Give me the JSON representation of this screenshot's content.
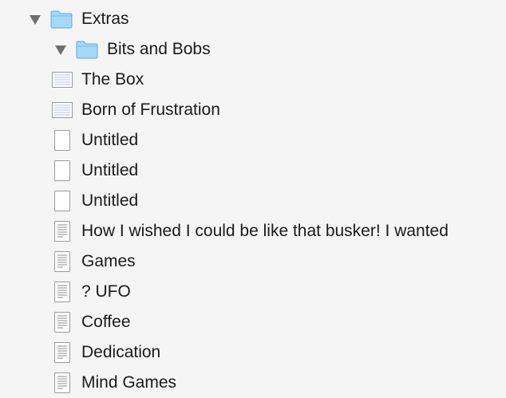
{
  "binder": {
    "rows": [
      {
        "label": "Extras",
        "icon": "folder-icon",
        "depth": 0,
        "expanded": true
      },
      {
        "label": "Bits and Bobs",
        "icon": "folder-icon",
        "depth": 1,
        "expanded": true
      },
      {
        "label": "The Box",
        "icon": "lined-document-icon",
        "depth": 0
      },
      {
        "label": "Born of Frustration",
        "icon": "lined-document-icon",
        "depth": 0
      },
      {
        "label": "Untitled",
        "icon": "blank-document-icon",
        "depth": 0
      },
      {
        "label": "Untitled",
        "icon": "blank-document-icon",
        "depth": 0
      },
      {
        "label": "Untitled",
        "icon": "blank-document-icon",
        "depth": 0
      },
      {
        "label": "How I wished I could be like that busker! I wanted",
        "icon": "text-document-icon",
        "depth": 0
      },
      {
        "label": "Games",
        "icon": "text-document-icon",
        "depth": 0
      },
      {
        "label": "? UFO",
        "icon": "text-document-icon",
        "depth": 0
      },
      {
        "label": "Coffee",
        "icon": "text-document-icon",
        "depth": 0
      },
      {
        "label": "Dedication",
        "icon": "text-document-icon",
        "depth": 0
      },
      {
        "label": "Mind Games",
        "icon": "text-document-icon",
        "depth": 0
      }
    ]
  },
  "colors": {
    "background": "#f5f5f5",
    "text": "#1a1a1a",
    "disclosure": "#6e6e6e",
    "folder_fill": "#a6d8f7",
    "folder_stroke": "#5aa9e0",
    "document_stroke": "#9a9a9a"
  }
}
